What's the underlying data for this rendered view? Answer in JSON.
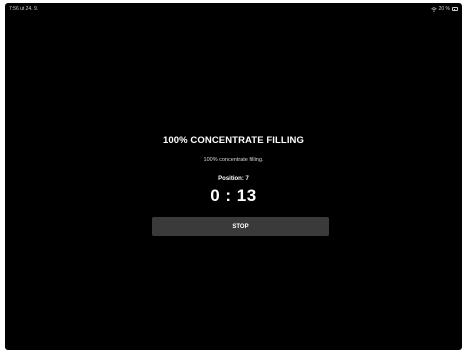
{
  "status_bar": {
    "time_date": "7:56  ut 24. 9.",
    "battery_text": "20 %",
    "battery_level": 0.2,
    "wifi_icon": "wifi-icon",
    "battery_icon": "battery-icon"
  },
  "screen": {
    "title": "100% CONCENTRATE FILLING",
    "subtitle": "100% concentrate filling.",
    "position_label": "Position: 7",
    "timer": "0 : 13",
    "stop_label": "STOP"
  },
  "colors": {
    "background": "#000000",
    "text": "#ffffff",
    "button": "#3a3a3a"
  }
}
